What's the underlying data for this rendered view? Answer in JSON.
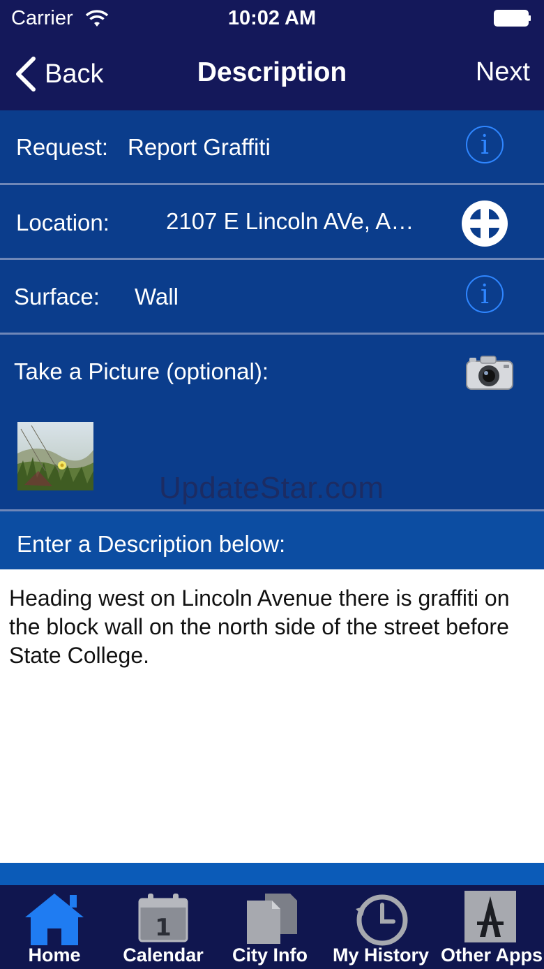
{
  "status": {
    "carrier": "Carrier",
    "time": "10:02 AM"
  },
  "nav": {
    "back_label": "Back",
    "title": "Description",
    "next_label": "Next"
  },
  "form": {
    "request_label": "Request:",
    "request_value": "Report Graffiti",
    "location_label": "Location:",
    "location_value": "2107 E Lincoln AVe, A…",
    "surface_label": "Surface:",
    "surface_value": "Wall",
    "picture_label": "Take a Picture (optional):",
    "watermark": "UpdateStar.com"
  },
  "description": {
    "header": "Enter a Description below:",
    "text": "Heading west on Lincoln Avenue there is graffiti on the block wall on the north side of the street before State College."
  },
  "icons": {
    "info": "info-icon",
    "location": "crosshair-icon",
    "camera": "camera-icon",
    "home": "home-icon",
    "calendar": "calendar-icon",
    "city_info": "documents-icon",
    "history": "history-clock-icon",
    "other_apps": "appstore-icon"
  },
  "colors": {
    "nav_bg": "#14185a",
    "row_bg": "#0b3d8c",
    "accent": "#2f86ff",
    "home_active": "#1f7cf2"
  },
  "tabs": [
    {
      "label": "Home",
      "active": true
    },
    {
      "label": "Calendar",
      "active": false
    },
    {
      "label": "City Info",
      "active": false
    },
    {
      "label": "My History",
      "active": false
    },
    {
      "label": "Other Apps",
      "active": false
    }
  ]
}
